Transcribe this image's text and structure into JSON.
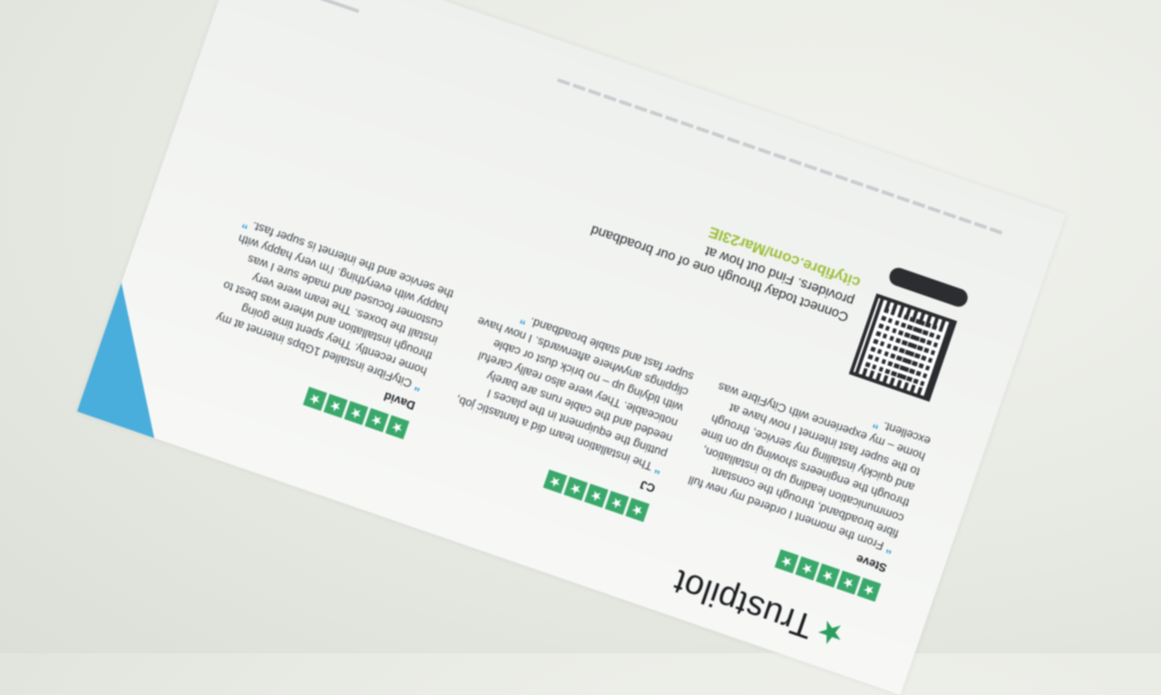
{
  "leaflet": {
    "brand": {
      "name": "Trustpilot",
      "icon": "star-icon"
    },
    "star_rating": 5,
    "reviews": [
      {
        "name": "Steve",
        "text": "From the moment I ordered my new full fibre broadband, through the constant communication leading up to installation, through the engineers showing up on time and quickly installing my service, through to the super fast internet I now have at home – my experience with CityFibre was excellent."
      },
      {
        "name": "CJ",
        "text": "The installation team did a fantastic job, putting the equipment in the places I needed and the cable runs are barely noticeable. They were also really careful with tidying up – no brick dust or cable clippings anywhere afterwards. I now have super fast and stable broadband."
      },
      {
        "name": "David",
        "text": "CityFibre installed 1Gbps internet at my home recently. They spent time going through installation and where was best to install the boxes. The team were very customer focused and made sure I was happy with everything. I'm very happy with the service and the internet is super fast."
      }
    ],
    "cta": {
      "text": "Connect today through one of our broadband providers. Find out how at",
      "link": "cityfibre.com/Mar23IE"
    },
    "colors": {
      "accent_blue": "#4aaedc",
      "star_green": "#3aa86b",
      "link_green": "#9cbf3c"
    }
  }
}
